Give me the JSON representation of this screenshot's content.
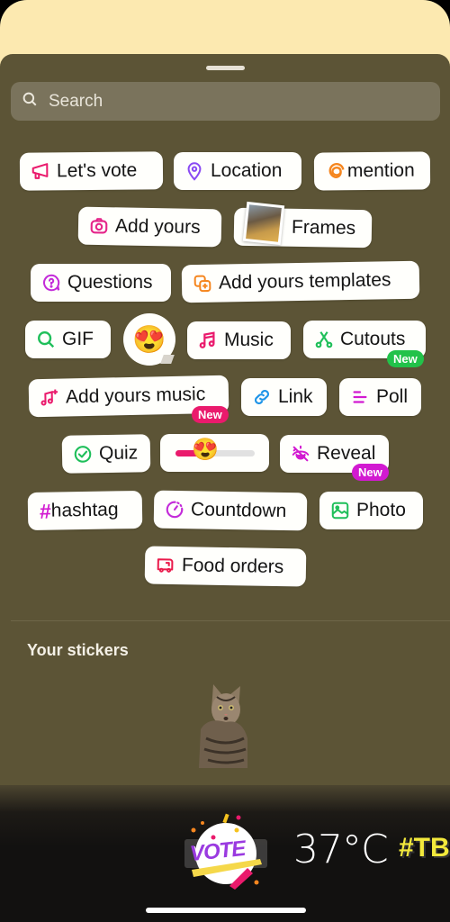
{
  "search": {
    "placeholder": "Search"
  },
  "stickers": {
    "lets_vote": "Let's vote",
    "location": "Location",
    "mention": "mention",
    "add_yours": "Add yours",
    "frames": "Frames",
    "questions": "Questions",
    "add_yours_templates": "Add yours templates",
    "gif": "GIF",
    "emoji_reaction": "😍",
    "music": "Music",
    "cutouts": "Cutouts",
    "add_yours_music": "Add yours music",
    "link": "Link",
    "poll": "Poll",
    "quiz": "Quiz",
    "slider_emoji": "😍",
    "slider_value": 0.35,
    "reveal": "Reveal",
    "hashtag": "hashtag",
    "hashtag_symbol": "#",
    "countdown": "Countdown",
    "photo": "Photo",
    "food_orders": "Food orders"
  },
  "badges": {
    "cutouts": "New",
    "add_yours_music": "New",
    "reveal": "New"
  },
  "colors": {
    "badge_green": "#22c24a",
    "badge_pink": "#ea1a6c",
    "badge_magenta": "#d21ad1"
  },
  "your_stickers": {
    "title": "Your stickers",
    "items": [
      "cat-cutout-sticker"
    ]
  },
  "tray": {
    "vote_sticker": "VOTE",
    "temperature": "37°C",
    "hashtag_sticker": "#TB"
  }
}
